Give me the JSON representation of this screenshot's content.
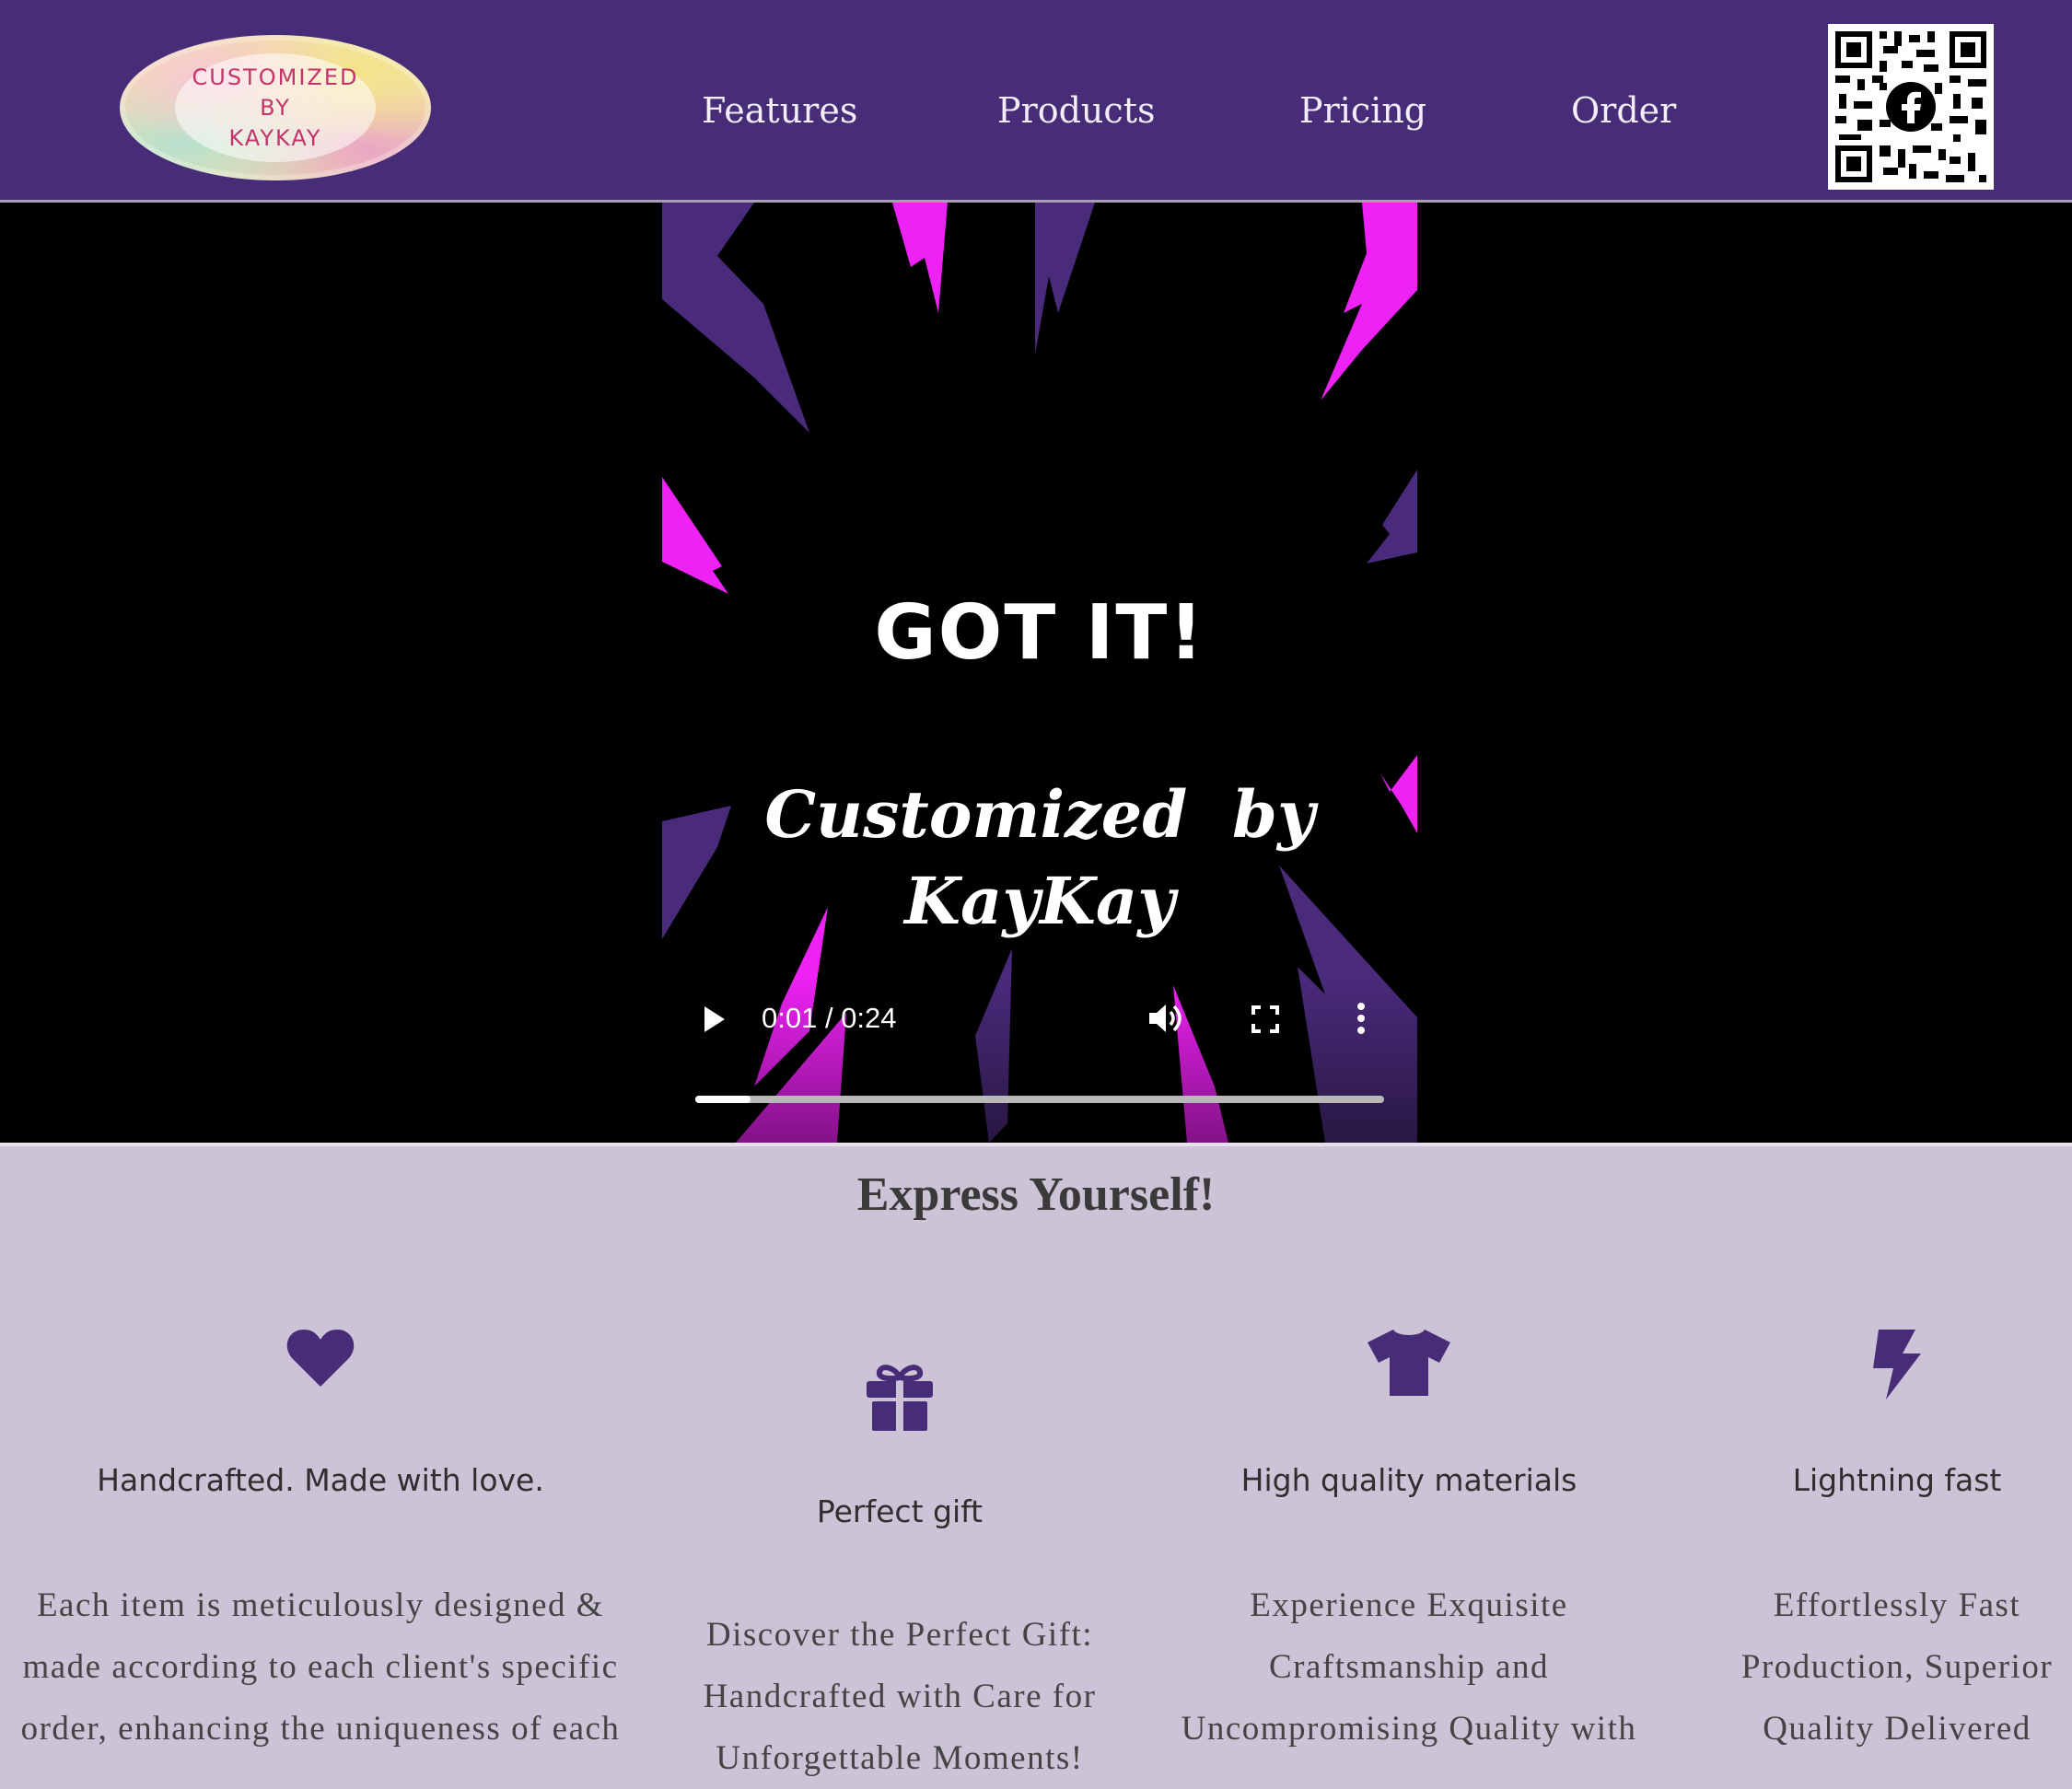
{
  "header": {
    "logo_lines": [
      "CUSTOMIZED",
      "BY",
      "KAYKAY"
    ],
    "nav": [
      "Features",
      "Products",
      "Pricing",
      "Order"
    ],
    "qr_icon": "qr-code-facebook-icon"
  },
  "video": {
    "title": "GOT IT!",
    "brand_line1": "Customized  by",
    "brand_line2": "KayKay",
    "time": "0:01 / 0:24",
    "progress": 0.08,
    "icons": [
      "play-icon",
      "volume-icon",
      "fullscreen-icon",
      "more-options-icon"
    ]
  },
  "features": {
    "title": "Express Yourself!",
    "items": [
      {
        "icon": "heart-icon",
        "heading": "Handcrafted. Made with love.",
        "body": "Each item is meticulously designed & made according to each client's specific order, enhancing the uniqueness of each"
      },
      {
        "icon": "gift-icon",
        "heading": "Perfect gift",
        "body": "Discover the Perfect Gift: Handcrafted with Care for Unforgettable Moments!"
      },
      {
        "icon": "tshirt-icon",
        "heading": "High quality materials",
        "body": "Experience Exquisite Craftsmanship and Uncompromising Quality with"
      },
      {
        "icon": "bolt-icon",
        "heading": "Lightning fast",
        "body": "Effortlessly Fast Production, Superior Quality Delivered"
      }
    ]
  },
  "colors": {
    "header_bg": "#472d78",
    "page_bg": "#cdc3d6",
    "accent": "#472d78",
    "magenta": "#ee22f5"
  }
}
